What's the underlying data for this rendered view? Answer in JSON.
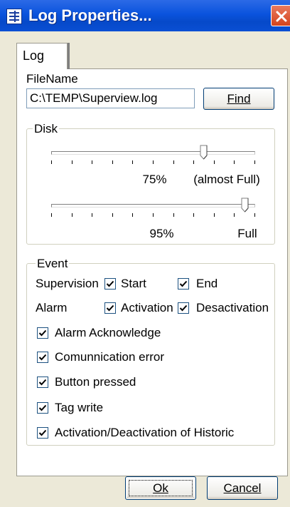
{
  "window": {
    "title": "Log Properties...",
    "close_icon": "close-x",
    "title_gradient": [
      "#2c6ae6",
      "#0649c9"
    ],
    "close_color": "#d5441c"
  },
  "tab": {
    "label": "Log"
  },
  "file": {
    "label": "FileName",
    "value": "C:\\TEMP\\Superview.log",
    "find_button": "Find"
  },
  "disk": {
    "legend": "Disk",
    "sliders": [
      {
        "value_percent": 75,
        "value_label": "75%",
        "end_label": "(almost Full)"
      },
      {
        "value_percent": 95,
        "value_label": "95%",
        "end_label": "Full"
      }
    ]
  },
  "event": {
    "legend": "Event",
    "supervision": {
      "label": "Supervision",
      "start": "Start",
      "end": "End",
      "start_checked": true,
      "end_checked": true
    },
    "alarm": {
      "label": "Alarm",
      "activation": "Activation",
      "deactivation": "Desactivation",
      "activation_checked": true,
      "deactivation_checked": true
    },
    "options": [
      {
        "label": "Alarm Acknowledge",
        "checked": true
      },
      {
        "label": "Comunnication error",
        "checked": true
      },
      {
        "label": "Button pressed",
        "checked": true
      },
      {
        "label": "Tag write",
        "checked": true
      },
      {
        "label": "Activation/Deactivation of Historic",
        "checked": true
      }
    ]
  },
  "buttons": {
    "ok": "Ok",
    "cancel": "Cancel"
  }
}
